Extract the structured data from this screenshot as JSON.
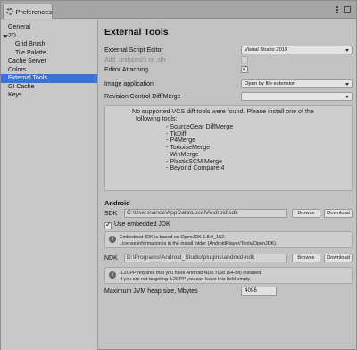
{
  "window": {
    "tab_title": "Preferences"
  },
  "sidebar": {
    "items": [
      {
        "label": "General"
      },
      {
        "label": "2D"
      },
      {
        "label": "Grid Brush"
      },
      {
        "label": "Tile Palette"
      },
      {
        "label": "Cache Server"
      },
      {
        "label": "Colors"
      },
      {
        "label": "External Tools"
      },
      {
        "label": "GI Cache"
      },
      {
        "label": "Keys"
      }
    ]
  },
  "main": {
    "title": "External Tools",
    "script_editor": {
      "label": "External Script Editor",
      "value": "Visual Studio 2019"
    },
    "add_unityproj": {
      "label": "Add .unityproj's to .sln",
      "checked": false
    },
    "editor_attaching": {
      "label": "Editor Attaching",
      "checked": true
    },
    "image_application": {
      "label": "Image application",
      "value": "Open by file extension"
    },
    "revision_control": {
      "label": "Revision Control Diff/Merge"
    },
    "vcs_help": {
      "line1": "No supported VCS diff tools were found. Please install one of the",
      "line2": "following tools:",
      "tools": [
        "- SourceGear DiffMerge",
        "- TkDiff",
        "- P4Merge",
        "- TortoiseMerge",
        "- WinMerge",
        "- PlasticSCM Merge",
        "- Beyond Compare 4"
      ]
    },
    "android": {
      "header": "Android",
      "sdk_label": "SDK",
      "sdk_path": "C:\\Users\\vince\\AppData\\Local\\Android\\sdk",
      "browse_label": "Browse",
      "download_label": "Download",
      "use_embedded_jdk": {
        "label": "Use embedded JDK",
        "checked": true
      },
      "jdk_info_line1": "Embedded JDK is based on OpenJDK 1.8.0_152.",
      "jdk_info_line2": "License information is in the install folder (AndroidPlayer/Tools/OpenJDK).",
      "ndk_label": "NDK",
      "ndk_path": "D:\\Programs\\Android_Studio\\plugins\\android-ndk",
      "il2cpp_line1": "IL2CPP requires that you have Android NDK r16b (64-bit) installed.",
      "il2cpp_line2": "If you are not targeting IL2CPP you can leave this field empty.",
      "heap_label": "Maximum JVM heap size, Mbytes",
      "heap_value": "4096"
    }
  }
}
